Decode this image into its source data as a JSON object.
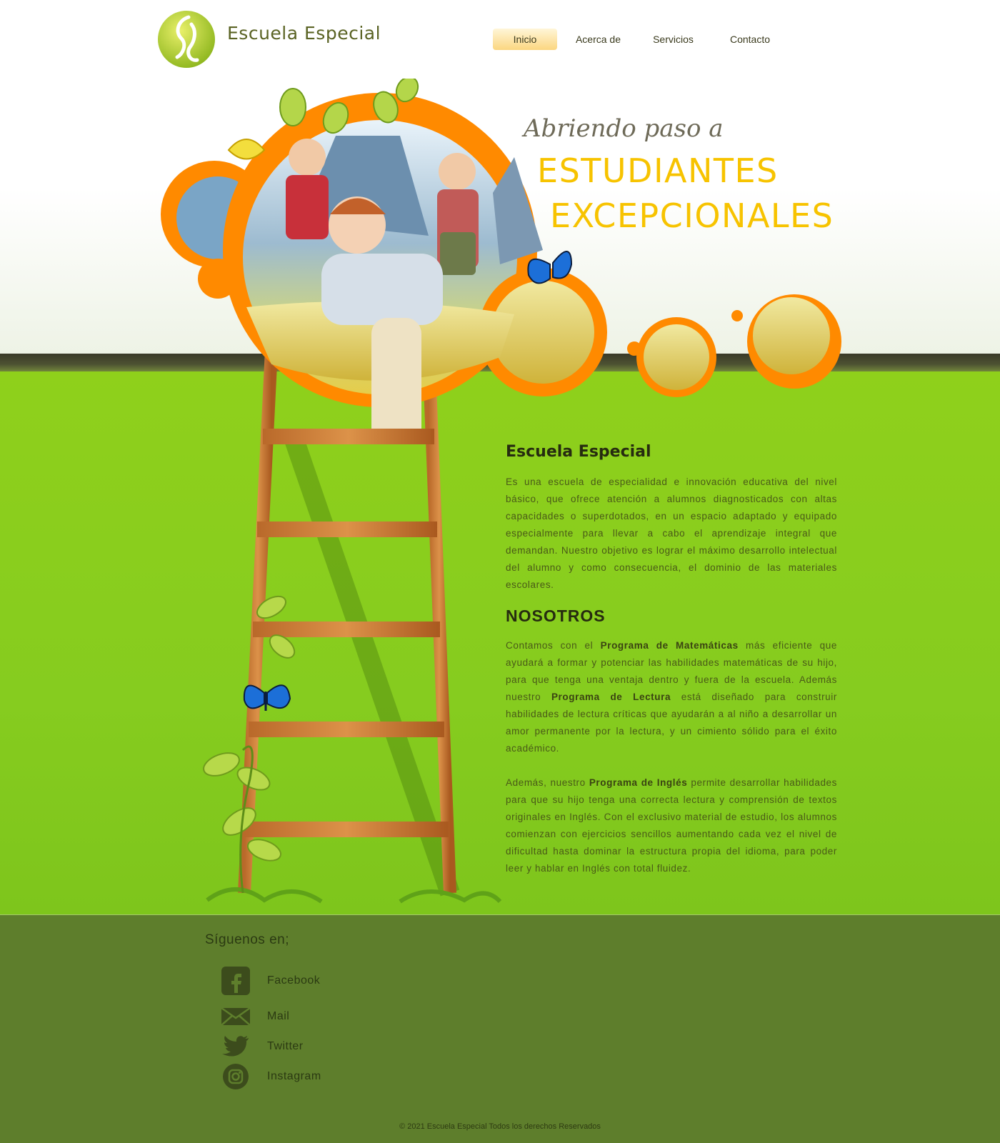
{
  "header": {
    "brand": "Escuela Especial",
    "nav": [
      {
        "label": "Inicio",
        "active": true
      },
      {
        "label": "Acerca de",
        "active": false
      },
      {
        "label": "Servicios",
        "active": false
      },
      {
        "label": "Contacto",
        "active": false
      }
    ]
  },
  "hero": {
    "tagline_small": "Abriendo paso a",
    "tagline_line1": "ESTUDIANTES",
    "tagline_line2": "EXCEPCIONALES"
  },
  "main": {
    "intro_title": "Escuela Especial",
    "intro_text": "Es una escuela de especialidad e innovación educativa del nivel básico, que ofrece atención a alumnos diagnosticados con altas capacidades o superdotados, en un espacio adaptado y equipado especialmente para llevar a cabo el aprendizaje integral que demandan. Nuestro objetivo es lograr el máximo desarrollo intelectual del alumno y como consecuencia, el dominio de las materiales escolares.",
    "about_title": "NOSOTROS",
    "about_p1": {
      "t1": "Contamos con el ",
      "b1": "Programa de Matemáticas",
      "t2": " más eficiente que ayudará a formar y potenciar las habilidades matemáticas de su hijo, para que tenga una ventaja dentro y fuera de la escuela. Además nuestro ",
      "b2": "Programa de Lectura",
      "t3": " está diseñado para construir habilidades de lectura críticas que ayudarán a al niño a desarrollar un amor permanente por la lectura, y un cimiento sólido para el éxito académico."
    },
    "about_p2": {
      "t1": "Además, nuestro ",
      "b1": "Programa de Inglés",
      "t2": " permite desarrollar habilidades para que su hijo tenga una correcta lectura y comprensión de textos originales en Inglés. Con el exclusivo material de estudio, los alumnos comienzan con ejercicios sencillos aumentando cada vez el nivel de dificultad hasta dominar la estructura propia del idioma, para poder leer y hablar en Inglés con total fluidez."
    }
  },
  "footer": {
    "follow_title": "Síguenos en;",
    "social": [
      {
        "label": "Facebook",
        "icon": "facebook-icon"
      },
      {
        "label": "Mail",
        "icon": "mail-icon"
      },
      {
        "label": "Twitter",
        "icon": "twitter-icon"
      },
      {
        "label": "Instagram",
        "icon": "instagram-icon"
      }
    ],
    "copyright": "© 2021 Escuela Especial Todos los derechos Reservados"
  },
  "colors": {
    "accent_orange": "#ff8a00",
    "tagline_yellow": "#f7c300",
    "main_green": "#8bce1c",
    "footer_green": "#5e7e2c",
    "nav_active": "#fbd680"
  }
}
